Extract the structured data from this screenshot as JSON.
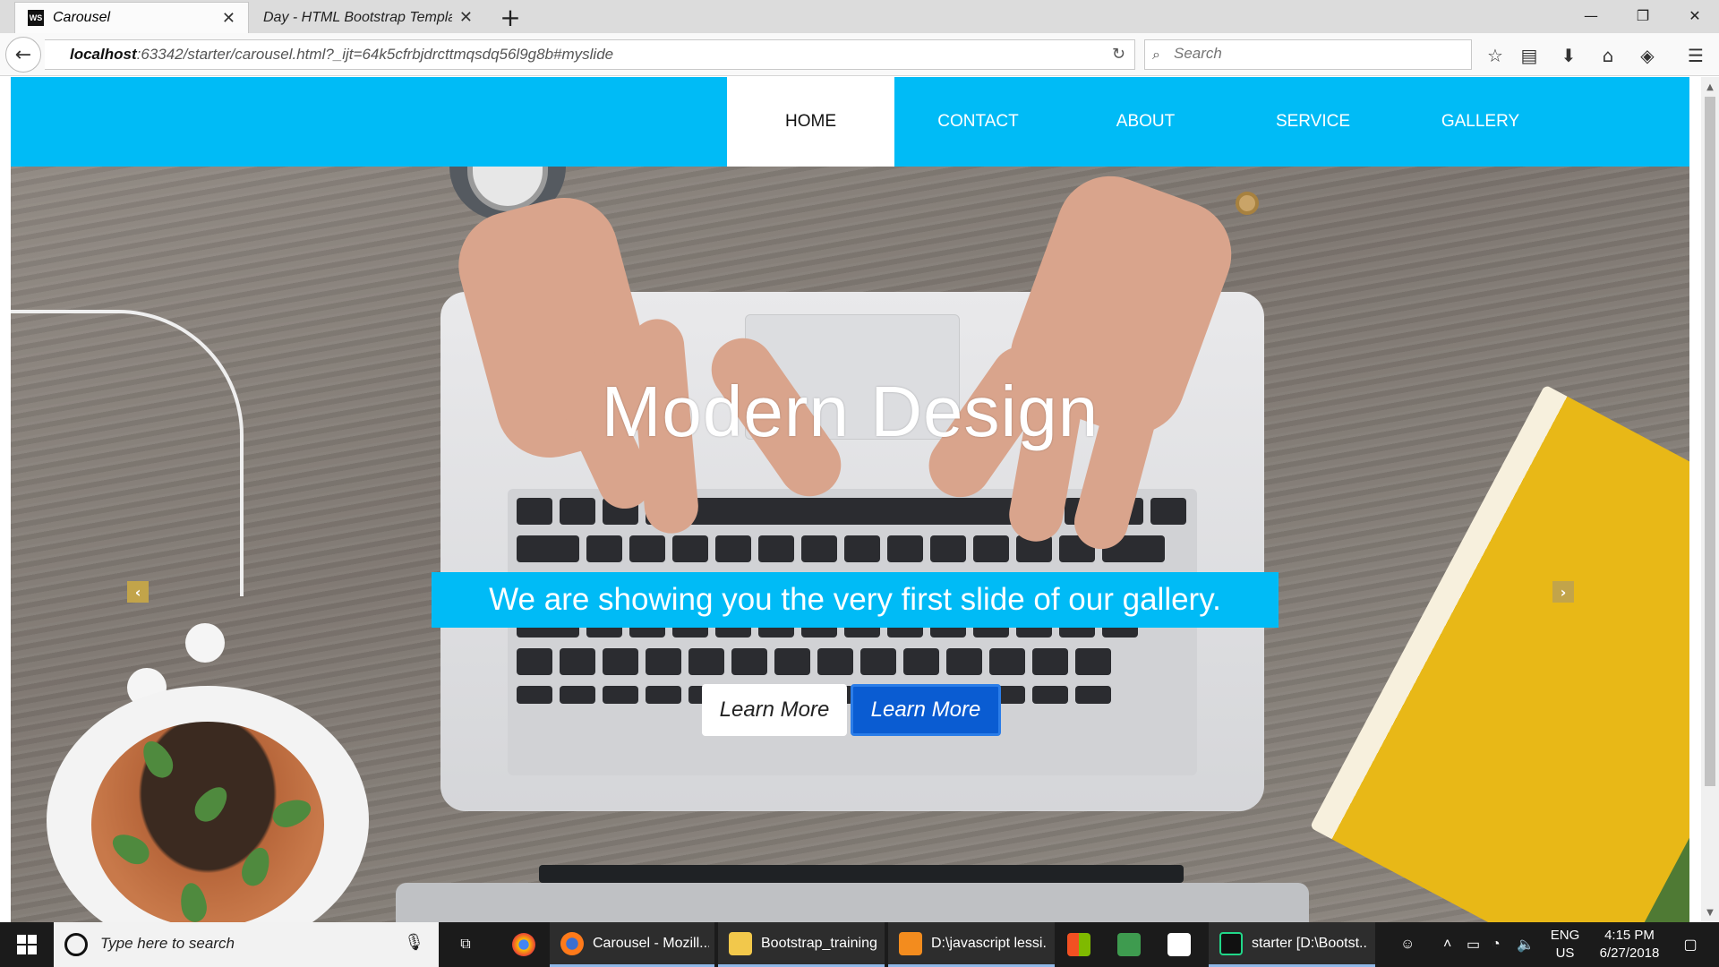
{
  "browser": {
    "tabs": [
      {
        "label": "Carousel",
        "favicon": "WS",
        "active": true
      },
      {
        "label": "Day - HTML Bootstrap Template",
        "active": false
      }
    ],
    "url_host": "localhost",
    "url_rest": ":63342/starter/carousel.html?_ijt=64k5cfrbjdrcttmqsdq56l9g8b#myslide",
    "search_placeholder": "Search"
  },
  "site": {
    "nav": [
      "HOME",
      "CONTACT",
      "ABOUT",
      "SERVICE",
      "GALLERY"
    ],
    "active_nav": "HOME",
    "brand_color": "#00bbf6",
    "slide": {
      "title": "Modern Design",
      "subtitle": "We are showing you the very first slide of our gallery.",
      "buttons": [
        "Learn More",
        "Learn More"
      ]
    }
  },
  "taskbar": {
    "search_placeholder": "Type here to search",
    "apps": [
      {
        "label": "Carousel - Mozill...",
        "icon": "firefox-icon"
      },
      {
        "label": "Bootstrap_training",
        "icon": "folder-icon"
      },
      {
        "label": "D:\\javascript lessi...",
        "icon": "sublime-icon"
      },
      {
        "label": "starter [D:\\Bootst...",
        "icon": "webstorm-icon"
      }
    ],
    "lang_top": "ENG",
    "lang_bottom": "US",
    "time": "4:15 PM",
    "date": "6/27/2018"
  }
}
